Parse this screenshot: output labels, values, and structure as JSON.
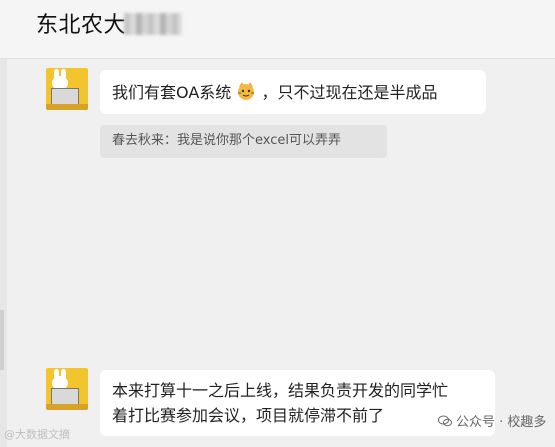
{
  "header": {
    "title": "东北农大"
  },
  "messages": [
    {
      "text_before_emoji": "我们有套OA系统",
      "emoji_name": "cat-face-emoji",
      "text_after_emoji": "，只不过现在还是半成品"
    },
    {
      "quote": "春去秋来：我是说你那个excel可以弄弄"
    },
    {
      "lines": [
        "本来打算十一之后上线，结果负责开发的同学忙",
        "着打比赛参加会议，项目就停滞不前了"
      ]
    }
  ],
  "watermarks": {
    "left": "@大数据文摘",
    "right": "公众号 · 校趣多"
  },
  "colors": {
    "background": "#f0f0f0",
    "header": "#f5f5f5",
    "bubble": "#ffffff",
    "quote": "#e3e3e3",
    "avatar": "#f2c52f"
  }
}
